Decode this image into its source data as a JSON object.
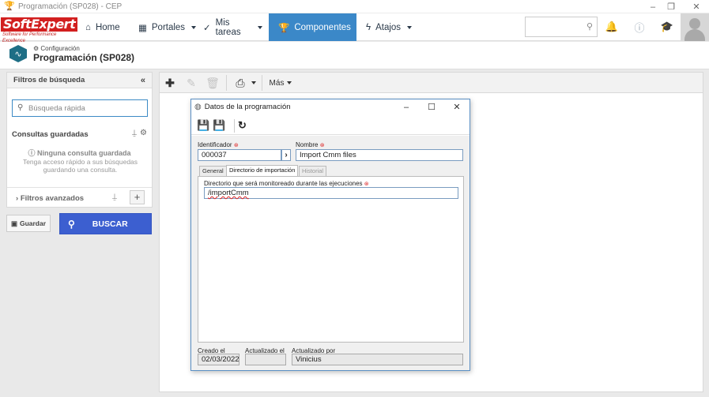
{
  "window": {
    "title": "Programación (SP028) - CEP"
  },
  "brand": {
    "logo_main": "SoftExpert",
    "logo_tagline": "Software for Performance Excellence"
  },
  "nav": {
    "items": [
      {
        "label": "Home"
      },
      {
        "label": "Portales"
      },
      {
        "label": "Mis tareas"
      },
      {
        "label": "Componentes"
      },
      {
        "label": "Atajos"
      }
    ]
  },
  "header": {
    "breadcrumb": "Configuración",
    "title": "Programación (SP028)"
  },
  "filters": {
    "title": "Filtros de búsqueda",
    "quick_search_placeholder": "Búsqueda rápida",
    "saved_title": "Consultas guardadas",
    "none_title": "Ninguna consulta guardada",
    "none_desc": "Tenga acceso rápido a sus búsquedas guardando una consulta.",
    "advanced_label": "Filtros avanzados",
    "save_label": "Guardar",
    "search_label": "BUSCAR"
  },
  "toolbar": {
    "more_label": "Más"
  },
  "dialog": {
    "title": "Datos de la programación",
    "id_label": "Identificador",
    "id_value": "000037",
    "name_label": "Nombre",
    "name_value": "Import Cmm files",
    "tabs": [
      {
        "label": "General"
      },
      {
        "label": "Directorio de importación"
      },
      {
        "label": "Historial"
      }
    ],
    "dir_label": "Directorio que será monitoreado durante las ejecuciones",
    "dir_value": "/importCmm",
    "created_label": "Creado el",
    "created_value": "02/03/2022",
    "updated_label": "Actualizado el",
    "updated_value": "",
    "updated_by_label": "Actualizado por",
    "updated_by_value": "Vinicius"
  },
  "colors": {
    "accent": "#3b88c8",
    "search_button": "#3c5fd0",
    "required": "#d22222"
  }
}
